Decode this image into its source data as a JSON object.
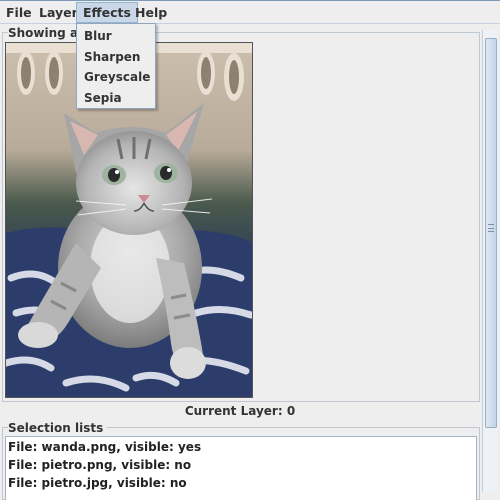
{
  "menubar": {
    "items": [
      "File",
      "Layer",
      "Effects",
      "Help"
    ],
    "open_menu": "Effects"
  },
  "effects_menu": {
    "items": [
      "Blur",
      "Sharpen",
      "Greyscale",
      "Sepia"
    ]
  },
  "image_panel": {
    "title": "Showing an"
  },
  "image": {
    "subject": "grey tabby kitten on blue and white blanket"
  },
  "status": {
    "current_layer": "Current Layer: 0"
  },
  "selection": {
    "title": "Selection lists",
    "items": [
      "File: wanda.png, visible: yes",
      "File: pietro.png, visible: no",
      "File: pietro.jpg, visible: no"
    ]
  },
  "colors": {
    "background": "#eeeeee",
    "menu_highlight": "#c8d8e8",
    "list_background": "#ffffff"
  }
}
